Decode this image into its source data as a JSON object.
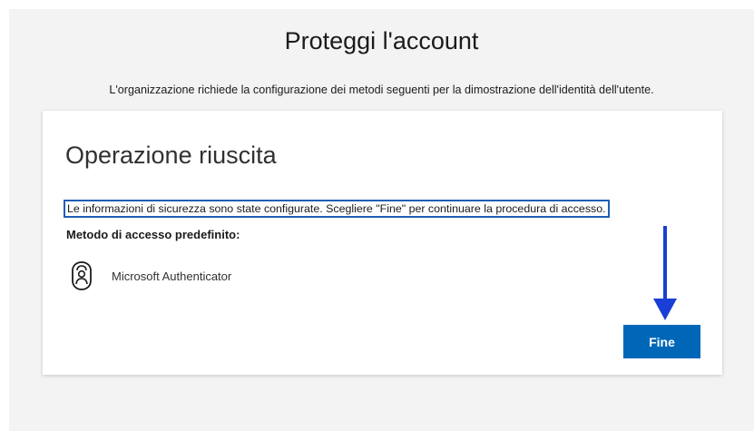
{
  "header": {
    "title": "Proteggi l'account",
    "subtitle": "L'organizzazione richiede la configurazione dei metodi seguenti per la dimostrazione dell'identità dell'utente."
  },
  "card": {
    "title": "Operazione riuscita",
    "info_text": "Le informazioni di sicurezza sono state configurate. Scegliere \"Fine\" per continuare la procedura di accesso.",
    "method_label": "Metodo di accesso predefinito:",
    "method": {
      "icon": "authenticator-icon",
      "name": "Microsoft Authenticator"
    },
    "done_button_label": "Fine"
  },
  "colors": {
    "accent": "#0067b8",
    "arrow": "#1a3fd6",
    "background": "#f3f3f3",
    "highlight_border": "#1f5fb6"
  }
}
